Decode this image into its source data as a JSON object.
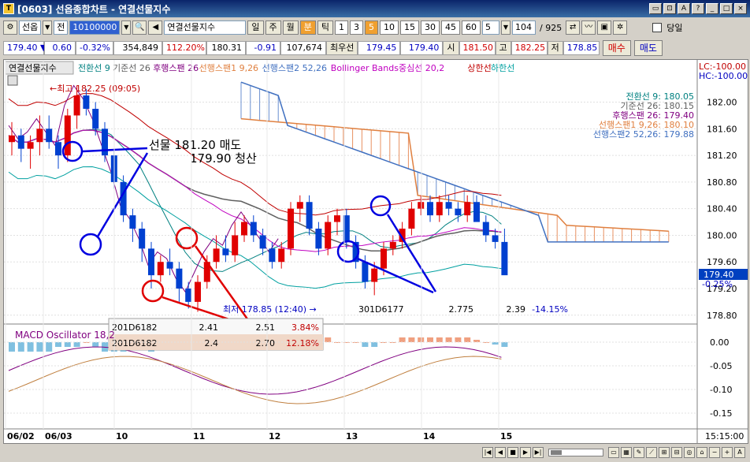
{
  "window": {
    "title": "[0603] 선옵종합차트 - 연결선물지수"
  },
  "toolbar": {
    "market": "선옵",
    "prefix": "전",
    "code": "10100000",
    "name": "연결선물지수",
    "periods": [
      "일",
      "주",
      "월",
      "분",
      "틱",
      "1",
      "3",
      "5",
      "10",
      "15",
      "30",
      "45",
      "60"
    ],
    "period_selected": "분",
    "interval_selected": "5",
    "interval_value": "5",
    "count_value": "104",
    "count_total": "/ 925",
    "today_label": "당일"
  },
  "quotes": {
    "price": "179.40 ▼",
    "change": "0.60",
    "change_pct": "-0.32%",
    "volume": "354,849",
    "volume_pct": "112.20%",
    "theory": "180.31",
    "basis": "-0.91",
    "open_interest": "107,674",
    "best_label": "최우선",
    "ask": "179.45",
    "bid": "179.40",
    "open_label": "시",
    "open": "181.50",
    "high_label": "고",
    "high": "182.25",
    "low_label": "저",
    "low": "178.85",
    "buy_label": "매수",
    "sell_label": "매도"
  },
  "legend": {
    "main": "연결선물지수",
    "items": [
      {
        "label": "전환선 9",
        "color": "#008080"
      },
      {
        "label": "기준선 26",
        "color": "#606060"
      },
      {
        "label": "후행스팬 26",
        "color": "#800080"
      },
      {
        "label": "선행스팬1 9,26",
        "color": "#e08040"
      },
      {
        "label": "선행스팬2 52,26",
        "color": "#4070c0"
      },
      {
        "label": "Bollinger Bands중심선 20,2",
        "color": "#c000c0"
      },
      {
        "label": "상한선",
        "color": "#c00000"
      },
      {
        "label": "하한선",
        "color": "#00a0a0"
      }
    ],
    "lc": "LC:-100.00",
    "hc": "HC:-100.00"
  },
  "values_panel": [
    {
      "text": "전환선 9: 180.05",
      "color": "#008080"
    },
    {
      "text": "기준선 26: 180.15",
      "color": "#606060"
    },
    {
      "text": "후행스팬 26: 179.40",
      "color": "#800080"
    },
    {
      "text": "선행스팬1 9,26: 180.10",
      "color": "#e08040"
    },
    {
      "text": "선행스팬2 52,26: 179.88",
      "color": "#4070c0"
    }
  ],
  "annotations": {
    "high": "←최고 182.25 (09:05)",
    "low": "최저 178.85 (12:40) →",
    "trade_line1": "선물 181.20 매도",
    "trade_line2": "179.90 청산"
  },
  "price_axis": {
    "ticks": [
      "182.00",
      "181.60",
      "181.20",
      "180.80",
      "180.40",
      "180.00",
      "179.60",
      "179.20",
      "178.80"
    ],
    "current": "179.40",
    "current_pct": "-0.25%"
  },
  "macd": {
    "label": "MACD Oscillator 18,2",
    "ticks": [
      "0.00",
      "-0.05",
      "-0.10",
      "-0.15"
    ]
  },
  "options_table": [
    {
      "code": "201D6182",
      "a": "2.41",
      "b": "2.51",
      "pct": "3.84%"
    },
    {
      "code": "201D6182",
      "a": "2.4",
      "b": "2.70",
      "pct": "12.18%"
    }
  ],
  "put_row": {
    "code": "301D6177",
    "a": "2.775",
    "b": "2.39",
    "pct": "-14.15%"
  },
  "x_axis": {
    "labels": [
      "06/02",
      "06/03",
      "10",
      "11",
      "12",
      "13",
      "14",
      "15"
    ],
    "time": "15:15:00"
  },
  "chart_data": {
    "type": "candlestick",
    "y_range": [
      178.75,
      182.35
    ],
    "candles": [
      [
        181.4,
        181.7,
        181.2,
        181.5
      ],
      [
        181.5,
        181.6,
        181.1,
        181.3
      ],
      [
        181.3,
        181.5,
        181.0,
        181.4
      ],
      [
        181.4,
        181.8,
        181.2,
        181.6
      ],
      [
        181.6,
        181.8,
        181.3,
        181.4
      ],
      [
        181.4,
        181.5,
        181.0,
        181.2
      ],
      [
        181.2,
        181.9,
        181.1,
        181.8
      ],
      [
        181.8,
        182.25,
        181.6,
        182.1
      ],
      [
        182.1,
        182.2,
        181.8,
        181.9
      ],
      [
        181.9,
        182.0,
        181.5,
        181.6
      ],
      [
        181.6,
        181.7,
        181.1,
        181.2
      ],
      [
        181.2,
        181.3,
        180.7,
        180.8
      ],
      [
        180.8,
        180.9,
        180.2,
        180.3
      ],
      [
        180.3,
        180.4,
        179.9,
        180.1
      ],
      [
        180.1,
        180.2,
        179.6,
        179.8
      ],
      [
        179.8,
        179.9,
        179.2,
        179.4
      ],
      [
        179.4,
        179.7,
        179.3,
        179.6
      ],
      [
        179.6,
        179.8,
        179.4,
        179.5
      ],
      [
        179.5,
        179.6,
        179.0,
        179.2
      ],
      [
        179.2,
        179.3,
        178.9,
        179.0
      ],
      [
        179.0,
        179.4,
        178.85,
        179.3
      ],
      [
        179.3,
        179.7,
        179.2,
        179.6
      ],
      [
        179.6,
        180.0,
        179.5,
        179.8
      ],
      [
        179.8,
        180.0,
        179.6,
        179.7
      ],
      [
        179.7,
        180.2,
        179.6,
        180.0
      ],
      [
        180.0,
        180.3,
        179.9,
        180.2
      ],
      [
        180.2,
        180.3,
        179.9,
        180.0
      ],
      [
        180.0,
        180.1,
        179.7,
        179.8
      ],
      [
        179.8,
        179.9,
        179.5,
        179.6
      ],
      [
        179.6,
        179.9,
        179.5,
        179.8
      ],
      [
        179.8,
        180.5,
        179.7,
        180.4
      ],
      [
        180.4,
        180.6,
        180.2,
        180.5
      ],
      [
        180.5,
        180.6,
        180.0,
        180.1
      ],
      [
        180.1,
        180.2,
        179.7,
        179.8
      ],
      [
        179.8,
        180.3,
        179.7,
        180.2
      ],
      [
        180.2,
        180.4,
        180.0,
        180.3
      ],
      [
        180.3,
        180.4,
        179.8,
        179.9
      ],
      [
        179.9,
        180.0,
        179.5,
        179.6
      ],
      [
        179.6,
        179.7,
        179.2,
        179.3
      ],
      [
        179.3,
        179.6,
        179.1,
        179.5
      ],
      [
        179.5,
        179.9,
        179.4,
        179.8
      ],
      [
        179.8,
        180.0,
        179.7,
        179.9
      ],
      [
        179.9,
        180.2,
        179.8,
        180.1
      ],
      [
        180.1,
        180.5,
        180.0,
        180.4
      ],
      [
        180.4,
        180.6,
        180.3,
        180.5
      ],
      [
        180.5,
        180.6,
        180.2,
        180.3
      ],
      [
        180.3,
        180.6,
        180.2,
        180.5
      ],
      [
        180.5,
        180.6,
        180.3,
        180.4
      ],
      [
        180.4,
        180.5,
        180.2,
        180.3
      ],
      [
        180.3,
        180.6,
        180.2,
        180.5
      ],
      [
        180.5,
        180.6,
        180.2,
        180.2
      ],
      [
        180.2,
        180.3,
        179.9,
        180.0
      ],
      [
        180.0,
        180.1,
        179.8,
        179.9
      ],
      [
        179.9,
        180.1,
        179.6,
        179.4
      ]
    ],
    "macd_hist": [
      -0.02,
      -0.02,
      -0.02,
      -0.02,
      -0.02,
      -0.01,
      -0.01,
      -0.01,
      0.0,
      -0.01,
      -0.02,
      -0.02,
      -0.02,
      -0.01,
      -0.01,
      -0.02,
      -0.01,
      -0.01,
      -0.01,
      -0.01,
      -0.01,
      0.0,
      0.0,
      0.0,
      0.0,
      0.0,
      -0.01,
      -0.01,
      -0.01,
      -0.01,
      0.0,
      0.01,
      0.01,
      0.01,
      0.01,
      0.0,
      0.0,
      0.0,
      -0.01,
      -0.01,
      0.0,
      0.0,
      0.01,
      0.01,
      0.01,
      0.01,
      0.01,
      0.01,
      0.01,
      0.01,
      0.005,
      0.0,
      -0.005,
      -0.01
    ],
    "macd_range": [
      -0.18,
      0.03
    ]
  }
}
